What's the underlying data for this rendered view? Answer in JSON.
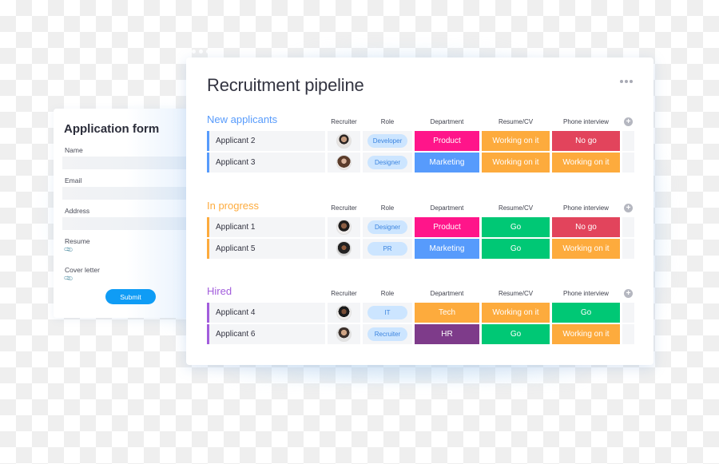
{
  "application_form": {
    "title": "Application form",
    "fields": [
      {
        "label": "Name",
        "value": ""
      },
      {
        "label": "Email",
        "value": ""
      },
      {
        "label": "Address",
        "value": ""
      }
    ],
    "attachments": [
      {
        "label": "Resume",
        "icon": "paperclip-icon"
      },
      {
        "label": "Cover letter",
        "icon": "paperclip-icon"
      }
    ],
    "submit_label": "Submit",
    "submit_color": "#0f9cf5"
  },
  "board": {
    "title": "Recruitment pipeline",
    "more_icon": "ellipsis-icon",
    "columns": [
      "Recruiter",
      "Role",
      "Department",
      "Resume/CV",
      "Phone interview"
    ],
    "add_column_icon": "plus-circle-icon",
    "groups": [
      {
        "title": "New applicants",
        "color": "#579bfc",
        "rows": [
          {
            "name": "Applicant 2",
            "role": "Developer",
            "department": "Product",
            "resume": "Working on it",
            "phone": "No go"
          },
          {
            "name": "Applicant 3",
            "role": "Designer",
            "department": "Marketing",
            "resume": "Working on it",
            "phone": "Working on it"
          }
        ]
      },
      {
        "title": "In progress",
        "color": "#fdab3d",
        "rows": [
          {
            "name": "Applicant 1",
            "role": "Designer",
            "department": "Product",
            "resume": "Go",
            "phone": "No go"
          },
          {
            "name": "Applicant 5",
            "role": "PR",
            "department": "Marketing",
            "resume": "Go",
            "phone": "Working on it"
          }
        ]
      },
      {
        "title": "Hired",
        "color": "#a25ddc",
        "rows": [
          {
            "name": "Applicant 4",
            "role": "IT",
            "department": "Tech",
            "resume": "Working on it",
            "phone": "Go"
          },
          {
            "name": "Applicant 6",
            "role": "Recruiter",
            "department": "HR",
            "resume": "Go",
            "phone": "Working on it"
          }
        ]
      }
    ],
    "status_colors": {
      "Product": "#ff158a",
      "Marketing": "#579bfc",
      "Tech": "#fdab3d",
      "HR": "#7e3b8a",
      "Working on it": "#fdab3d",
      "No go": "#e2445c",
      "Go": "#00c875"
    }
  }
}
